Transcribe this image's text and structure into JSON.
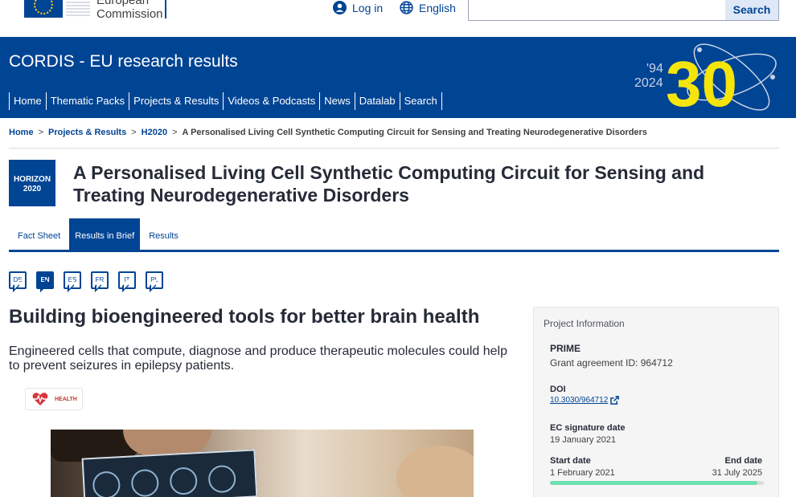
{
  "topbar": {
    "org_name_line1": "European",
    "org_name_line2": "Commission",
    "login_label": "Log in",
    "language_label": "English",
    "search_placeholder": "",
    "search_button": "Search"
  },
  "header": {
    "site_title": "CORDIS - EU research results",
    "nav": [
      "Home",
      "Thematic Packs",
      "Projects & Results",
      "Videos & Podcasts",
      "News",
      "Datalab",
      "Search"
    ],
    "anniversary": {
      "start": "'94",
      "end": "2024",
      "number": "30"
    }
  },
  "breadcrumb": [
    "Home",
    "Projects & Results",
    "H2020",
    "A Personalised Living Cell Synthetic Computing Circuit for Sensing and Treating Neurodegenerative Disorders"
  ],
  "programme_badge": {
    "line1": "HORIZON",
    "line2": "2020"
  },
  "project_title": "A Personalised Living Cell Synthetic Computing Circuit for Sensing and Treating Neurodegenerative Disorders",
  "tabs": [
    {
      "label": "Fact Sheet",
      "active": false
    },
    {
      "label": "Results in Brief",
      "active": true
    },
    {
      "label": "Results",
      "active": false
    }
  ],
  "languages": [
    {
      "code": "DE",
      "active": false
    },
    {
      "code": "EN",
      "active": true
    },
    {
      "code": "ES",
      "active": false
    },
    {
      "code": "FR",
      "active": false
    },
    {
      "code": "IT",
      "active": false
    },
    {
      "code": "PL",
      "active": false
    }
  ],
  "article": {
    "title": "Building bioengineered tools for better brain health",
    "lead": "Engineered cells that compute, diagnose and produce therapeutic molecules could help to prevent seizures in epilepsy patients.",
    "tag": "HEALTH",
    "tag_icon": "heart-pulse-icon"
  },
  "project_info": {
    "title": "Project Information",
    "acronym": "PRIME",
    "grant": "Grant agreement ID: 964712",
    "doi_label": "DOI",
    "doi": "10.3030/964712",
    "signature_label": "EC signature date",
    "signature_date": "19 January 2021",
    "start_label": "Start date",
    "start_date": "1 February 2021",
    "end_label": "End date",
    "end_date": "31 July 2025",
    "progress_fraction": 0.97
  },
  "colors": {
    "brand_blue": "#004494",
    "progress": "#6edfb0",
    "anniversary_yellow": "#f5e50a"
  }
}
